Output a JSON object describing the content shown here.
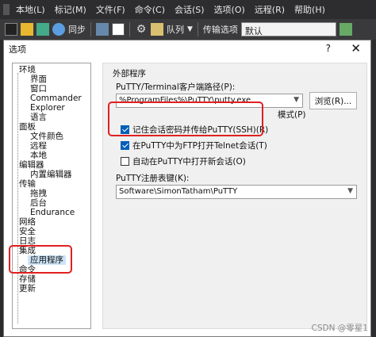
{
  "menubar": {
    "items": [
      "本地(L)",
      "标记(M)",
      "文件(F)",
      "命令(C)",
      "会话(S)",
      "选项(O)",
      "远程(R)",
      "帮助(H)"
    ]
  },
  "toolbar": {
    "sync_label": "同步",
    "queue_label": "队列",
    "transfer_options_label": "传输选项",
    "transfer_preset": "默认"
  },
  "dialog": {
    "title": "选项",
    "help": "?",
    "close": "✕"
  },
  "tree": {
    "items": [
      "环境",
      "界面",
      "窗口",
      "Commander",
      "Explorer",
      "语言",
      "面板",
      "文件颜色",
      "远程",
      "本地",
      "编辑器",
      "内置编辑器",
      "传输",
      "拖拽",
      "后台",
      "Endurance",
      "网络",
      "安全",
      "日志",
      "集成",
      "应用程序",
      "命令",
      "存储",
      "更新"
    ]
  },
  "panel": {
    "group_title": "外部程序",
    "putty_path_label": "PuTTY/Terminal客户端路径(P):",
    "putty_path_value": "%ProgramFiles%\\PuTTY\\putty.exe",
    "browse_label": "浏览(R)...",
    "pattern_label": "模式(P)",
    "remember_password_label": "记住会话密码并传给PuTTY(SSH)(R)",
    "remember_password_checked": true,
    "open_telnet_label": "在PuTTY中为FTP打开Telnet会话(T)",
    "open_telnet_checked": true,
    "auto_open_label": "自动在PuTTY中打开新会话(O)",
    "auto_open_checked": false,
    "registry_label": "PuTTY注册表键(K):",
    "registry_value": "Software\\SimonTatham\\PuTTY"
  },
  "watermark": "CSDN @零星1",
  "colors": {
    "highlight_border": "#e02020",
    "selection": "#cce4f7",
    "checkbox_checked": "#005fb8"
  }
}
